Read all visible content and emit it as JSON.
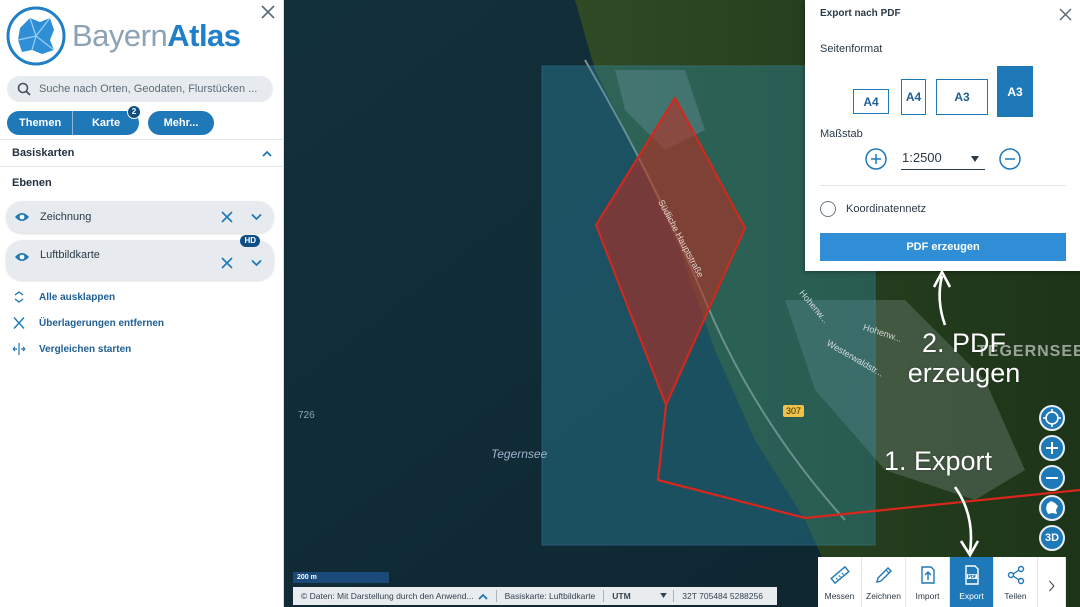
{
  "sidebar": {
    "logo": {
      "part1": "Bayern",
      "part2": "Atlas"
    },
    "search_placeholder": "Suche nach Orten, Geodaten, Flurstücken ...",
    "tabs": {
      "themen": "Themen",
      "karte": "Karte",
      "karte_badge": "2",
      "mehr": "Mehr..."
    },
    "basiskarten": "Basiskarten",
    "ebenen": "Ebenen",
    "layers": [
      {
        "label": "Zeichnung"
      },
      {
        "label": "Luftbildkarte",
        "badge": "HD"
      }
    ],
    "actions": {
      "expand_all": "Alle ausklappen",
      "remove_overlays": "Überlagerungen entfernen",
      "start_compare": "Vergleichen starten"
    }
  },
  "map": {
    "lake_label": "Tegernsee",
    "place_label": "TEGERNSEE",
    "elevation": "726",
    "road_number": "307",
    "streets": [
      "Südliche Hauptstraße",
      "Hohenw...",
      "Hohenw...",
      "Westerwaldstr..."
    ],
    "scale_bar": "200 m",
    "status": {
      "data_text": "© Daten: Mit Darstellung durch den Anwend...",
      "basemap": "Basiskarte: Luftbildkarte",
      "crs": "UTM",
      "coords": "32T 705484 5288256"
    }
  },
  "export_panel": {
    "title": "Export nach PDF",
    "page_format_label": "Seitenformat",
    "formats": [
      "A4",
      "A4",
      "A3",
      "A3"
    ],
    "selected_format_index": 3,
    "scale_label": "Maßstab",
    "scale_value": "1:2500",
    "grid_label": "Koordinatennetz",
    "submit_label": "PDF erzeugen"
  },
  "map_controls": {
    "three_d": "3D"
  },
  "toolbar": {
    "items": [
      "Messen",
      "Zeichnen",
      "Import",
      "Export",
      "Teilen"
    ],
    "active_index": 3
  },
  "annotations": {
    "step1": "1. Export",
    "step2_line1": "2. PDF",
    "step2_line2": "erzeugen"
  },
  "colors": {
    "accent": "#1f78b8",
    "drawing": "#d9261c",
    "export_frame": "#4aa8d8"
  }
}
